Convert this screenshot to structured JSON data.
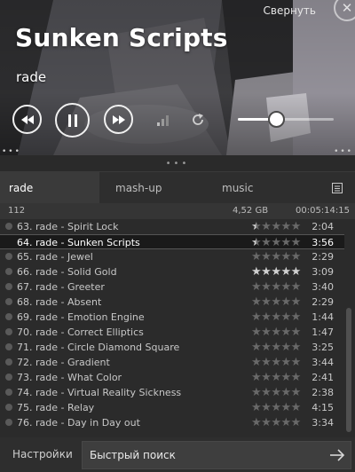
{
  "header": {
    "collapse_label": "Свернуть",
    "title": "Sunken Scripts",
    "artist": "rade",
    "volume": 0.4,
    "close_icon": "close-icon"
  },
  "tabs": [
    {
      "label": "rade",
      "active": true
    },
    {
      "label": "mash-up",
      "active": false
    },
    {
      "label": "music",
      "active": false
    }
  ],
  "stats": {
    "count": "112",
    "size": "4,52 GB",
    "duration": "00:05:14:15"
  },
  "tracks": [
    {
      "title": "63. rade - Spirit Lock",
      "rating": 0.5,
      "time": "2:04",
      "current": false
    },
    {
      "title": "64. rade - Sunken Scripts",
      "rating": 0.5,
      "time": "3:56",
      "current": true
    },
    {
      "title": "65. rade - Jewel",
      "rating": 0,
      "time": "2:29",
      "current": false
    },
    {
      "title": "66. rade - Solid Gold",
      "rating": 5,
      "time": "3:09",
      "current": false
    },
    {
      "title": "67. rade - Greeter",
      "rating": 0,
      "time": "3:40",
      "current": false
    },
    {
      "title": "68. rade - Absent",
      "rating": 0,
      "time": "2:29",
      "current": false
    },
    {
      "title": "69. rade - Emotion Engine",
      "rating": 0,
      "time": "1:44",
      "current": false
    },
    {
      "title": "70. rade - Correct Elliptics",
      "rating": 0,
      "time": "1:47",
      "current": false
    },
    {
      "title": "71. rade - Circle Diamond Square",
      "rating": 0,
      "time": "3:25",
      "current": false
    },
    {
      "title": "72. rade - Gradient",
      "rating": 0,
      "time": "3:44",
      "current": false
    },
    {
      "title": "73. rade - What Color",
      "rating": 0,
      "time": "2:41",
      "current": false
    },
    {
      "title": "74. rade - Virtual Reality Sickness",
      "rating": 0,
      "time": "2:38",
      "current": false
    },
    {
      "title": "75. rade - Relay",
      "rating": 0,
      "time": "4:15",
      "current": false
    },
    {
      "title": "76. rade - Day in Day out",
      "rating": 0,
      "time": "3:34",
      "current": false
    }
  ],
  "footer": {
    "settings_label": "Настройки",
    "search_placeholder": "Быстрый поиск"
  },
  "colors": {
    "background": "#2b2b2b",
    "current_row": "#1a1a1a",
    "star_on": "#d0d0d0",
    "star_off": "#696969"
  }
}
